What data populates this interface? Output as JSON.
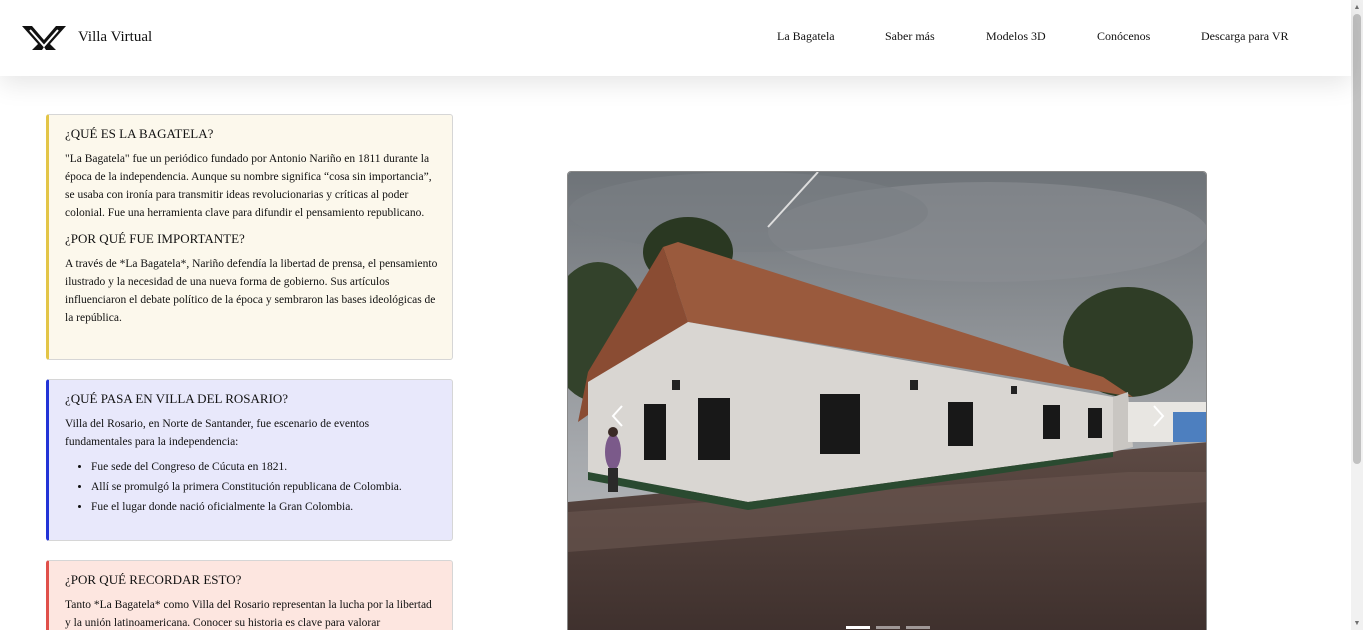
{
  "brand": {
    "name": "Villa Virtual",
    "logo_icon": "vv-logo-icon"
  },
  "nav": {
    "items": [
      "La Bagatela",
      "Saber más",
      "Modelos 3D",
      "Conócenos",
      "Descarga para VR"
    ]
  },
  "cards": {
    "bagatela": {
      "title1": "¿QUÉ ES LA BAGATELA?",
      "text1": "\"La Bagatela\" fue un periódico fundado por Antonio Nariño en 1811 durante la época de la independencia. Aunque su nombre significa “cosa sin importancia”, se usaba con ironía para transmitir ideas revolucionarias y críticas al poder colonial. Fue una herramienta clave para difundir el pensamiento republicano.",
      "title2": "¿POR QUÉ FUE IMPORTANTE?",
      "text2": "A través de *La Bagatela*, Nariño defendía la libertad de prensa, el pensamiento ilustrado y la necesidad de una nueva forma de gobierno. Sus artículos influenciaron el debate político de la época y sembraron las bases ideológicas de la república."
    },
    "rosario": {
      "title": "¿QUÉ PASA EN VILLA DEL ROSARIO?",
      "text": "Villa del Rosario, en Norte de Santander, fue escenario de eventos fundamentales para la independencia:",
      "items": [
        "Fue sede del Congreso de Cúcuta en 1821.",
        "Allí se promulgó la primera Constitución republicana de Colombia.",
        "Fue el lugar donde nació oficialmente la Gran Colombia."
      ]
    },
    "recordar": {
      "title": "¿POR QUÉ RECORDAR ESTO?",
      "text": "Tanto *La Bagatela* como Villa del Rosario representan la lucha por la libertad y la unión latinoamericana. Conocer su historia es clave para valorar"
    }
  },
  "carousel": {
    "prev_icon": "chevron-left-icon",
    "next_icon": "chevron-right-icon",
    "slides_count": 3,
    "active_index": 0
  },
  "colors": {
    "yellow_accent": "#e3c547",
    "blue_accent": "#2233d6",
    "red_accent": "#e0504a"
  }
}
